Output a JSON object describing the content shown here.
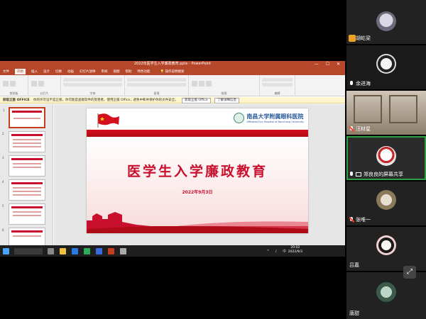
{
  "ppt": {
    "window_title": "2022年医学生入学廉政教育.pptx - PowerPoint",
    "window_controls": "— ☐ ✕",
    "tabs": [
      "文件",
      "开始",
      "插入",
      "设计",
      "切换",
      "动画",
      "幻灯片放映",
      "审阅",
      "视图",
      "帮助",
      "特色功能"
    ],
    "tell_me": "操作说明搜索",
    "ribbon_groups": [
      "剪贴板",
      "幻灯片",
      "字体",
      "段落",
      "绘图",
      "编辑"
    ],
    "notice": {
      "title": "获取正版 OFFICE",
      "text": "你的许可证不是正版，你可能是盗版软件的受害者。使用正版 Office，避免中断并保护你的文件安全。",
      "btn1": "获取正版 Office",
      "btn2": "了解详细信息"
    },
    "slide": {
      "university_name": "南昌大学附属眼科医院",
      "university_en": "Affiliated Eye Hospital of Nanchang University",
      "headline": "医学生入学廉政教育",
      "date": "2022年9月3日"
    },
    "status": {
      "slide_count": "幻灯片 第 1 张，共 21 张",
      "notes": "单击此处添加备注",
      "zoom": "78%"
    },
    "thumb_numbers": [
      "1",
      "2",
      "3",
      "4",
      "5",
      "6"
    ]
  },
  "taskbar": {
    "time": "20:02",
    "date": "2022/9/3",
    "tray": "^ ♪ 中"
  },
  "participants": [
    {
      "name": "胡屹梁",
      "muted": true
    },
    {
      "name": "余进海",
      "muted": false
    },
    {
      "name": "汪材星",
      "muted": true
    },
    {
      "name": "郑良良的屏幕共享",
      "muted": false,
      "sharing": true
    },
    {
      "name": "张唯一",
      "muted": true
    },
    {
      "name": "吕嘉",
      "muted": false
    },
    {
      "name": "唐甜",
      "muted": true
    }
  ],
  "colors": {
    "ppt_red": "#b7472a",
    "slide_red": "#c8102e",
    "speaker_green": "#2ea043"
  }
}
